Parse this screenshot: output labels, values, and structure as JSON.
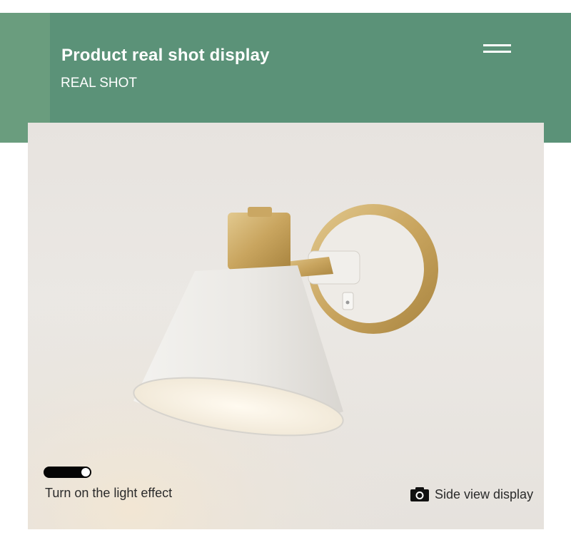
{
  "header": {
    "title": "Product real shot display",
    "subtitle": "REAL SHOT",
    "accent_color": "#5b9278",
    "menu_icon": "hamburger-menu-icon"
  },
  "photo": {
    "subject": "white and brass wall lamp"
  },
  "toggle": {
    "state": "on"
  },
  "captions": {
    "left": "Turn on the light effect",
    "right": "Side view display",
    "right_icon": "camera-icon"
  }
}
